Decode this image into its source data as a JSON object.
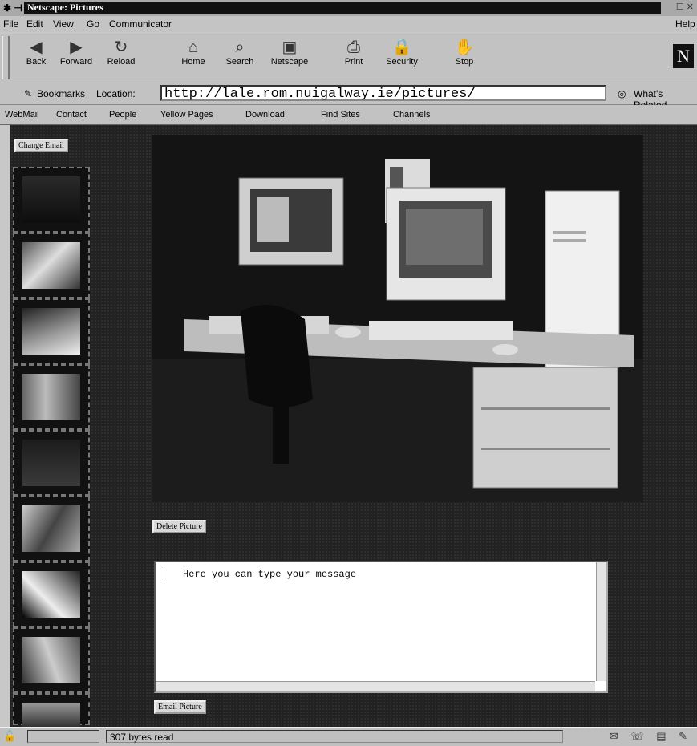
{
  "window": {
    "title": "Netscape: Pictures",
    "controls": "☐ ✕"
  },
  "menu": {
    "file": "File",
    "edit": "Edit",
    "view": "View",
    "go": "Go",
    "communicator": "Communicator",
    "help": "Help"
  },
  "toolbar": {
    "back": "Back",
    "forward": "Forward",
    "reload": "Reload",
    "home": "Home",
    "search": "Search",
    "netscape": "Netscape",
    "print": "Print",
    "security": "Security",
    "stop": "Stop",
    "logo": "N"
  },
  "location": {
    "bookmarks": "Bookmarks",
    "location_label": "Location:",
    "url": "http://lale.rom.nuigalway.ie/pictures/",
    "whats_related": "What's Related"
  },
  "personal_toolbar": [
    "WebMail",
    "Contact",
    "People",
    "Yellow Pages",
    "Download",
    "Find Sites",
    "Channels"
  ],
  "page": {
    "change_email_button": "Change Email",
    "delete_picture_button": "Delete Picture",
    "email_picture_button": "Email Picture",
    "message_text": "Here you can type your message"
  },
  "status": {
    "text": "307 bytes read"
  }
}
